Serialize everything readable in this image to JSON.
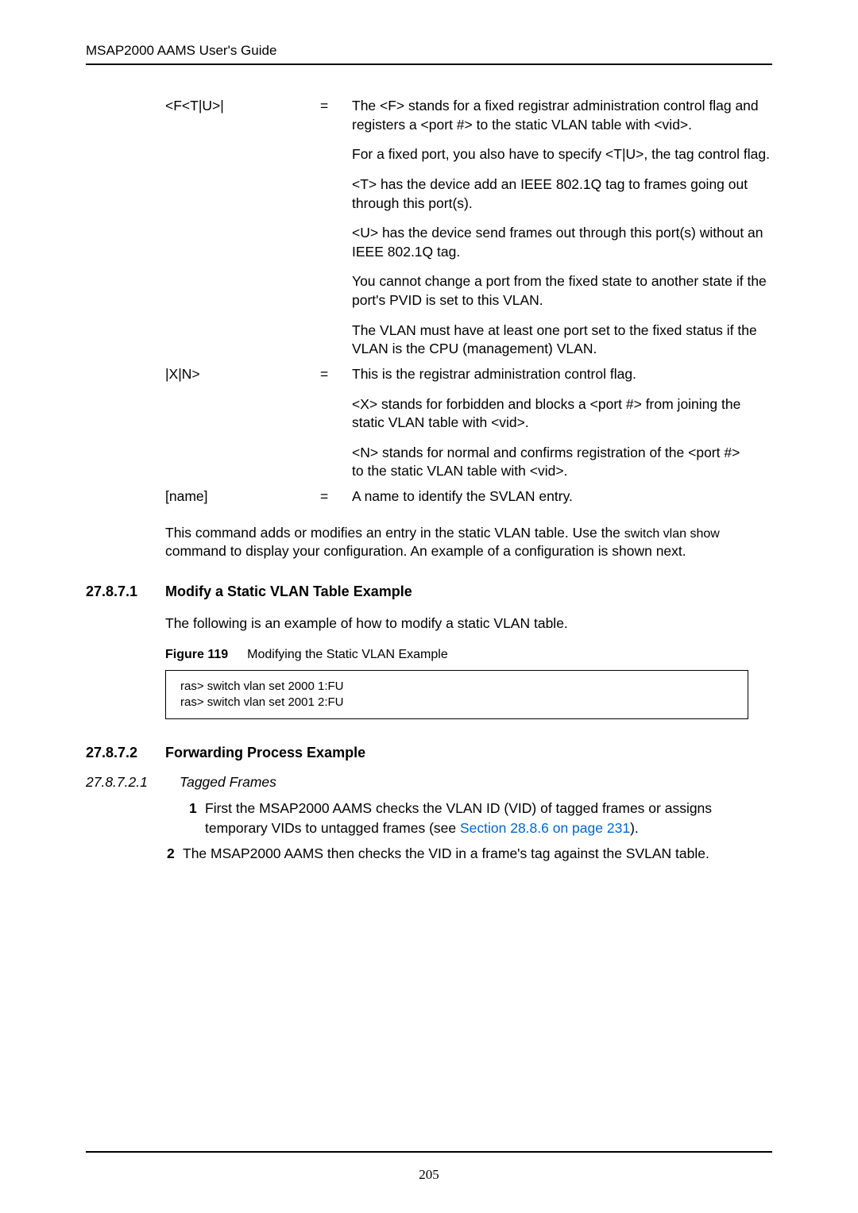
{
  "header": {
    "title": "MSAP2000 AAMS User's Guide"
  },
  "defs": [
    {
      "term": "<F<T|U>|",
      "eq": "=",
      "paras": [
        "The <F> stands for a fixed registrar administration control flag and registers a <port #> to the static VLAN table with <vid>.",
        "For a fixed port, you also have to specify <T|U>, the tag control flag.",
        "<T> has the device add an IEEE 802.1Q tag to frames going out through this port(s).",
        "<U> has the device send frames out through this port(s) without an IEEE 802.1Q tag.",
        "You cannot change a port from the fixed state to another state if the port's PVID is set to this VLAN.",
        "The VLAN must have at least one port set to the fixed status if the VLAN is the CPU (management) VLAN."
      ]
    },
    {
      "term": "|X|N>",
      "eq": "=",
      "paras": [
        "This is the registrar administration control flag.",
        "<X> stands for forbidden and blocks a <port #> from joining the static VLAN table with <vid>.",
        "<N> stands for normal and confirms registration of the <port #>\nto the static VLAN table with <vid>."
      ]
    },
    {
      "term": "[name]",
      "eq": "=",
      "paras": [
        "A name to identify the SVLAN entry."
      ]
    }
  ],
  "body_para": {
    "pre": "This command adds or modifies an entry in the static VLAN table. Use the ",
    "code1": "switch vlan show",
    "post": " command to display your configuration. An example of a configuration is shown next."
  },
  "sec1": {
    "num": "27.8.7.1",
    "title": "Modify a Static VLAN Table Example",
    "para": "The following is an example of how to modify a static VLAN table.",
    "fig_label": "Figure 119",
    "fig_caption": "Modifying the Static VLAN Example",
    "code": [
      "ras> switch vlan set 2000 1:FU",
      "ras> switch vlan set 2001 2:FU"
    ]
  },
  "sec2": {
    "num": "27.8.7.2",
    "title": "Forwarding Process Example",
    "sub_num": "27.8.7.2.1",
    "sub_title": "Tagged Frames",
    "items": [
      {
        "n": "1",
        "text_pre": "First the MSAP2000 AAMS checks the VLAN ID (VID) of tagged frames or assigns temporary VIDs to untagged frames (see ",
        "link": "Section 28.8.6 on page 231",
        "text_post": ")."
      },
      {
        "n": "2",
        "text_pre": "The MSAP2000 AAMS then checks the VID in a frame's tag against the SVLAN table.",
        "link": "",
        "text_post": ""
      }
    ]
  },
  "page_number": "205"
}
